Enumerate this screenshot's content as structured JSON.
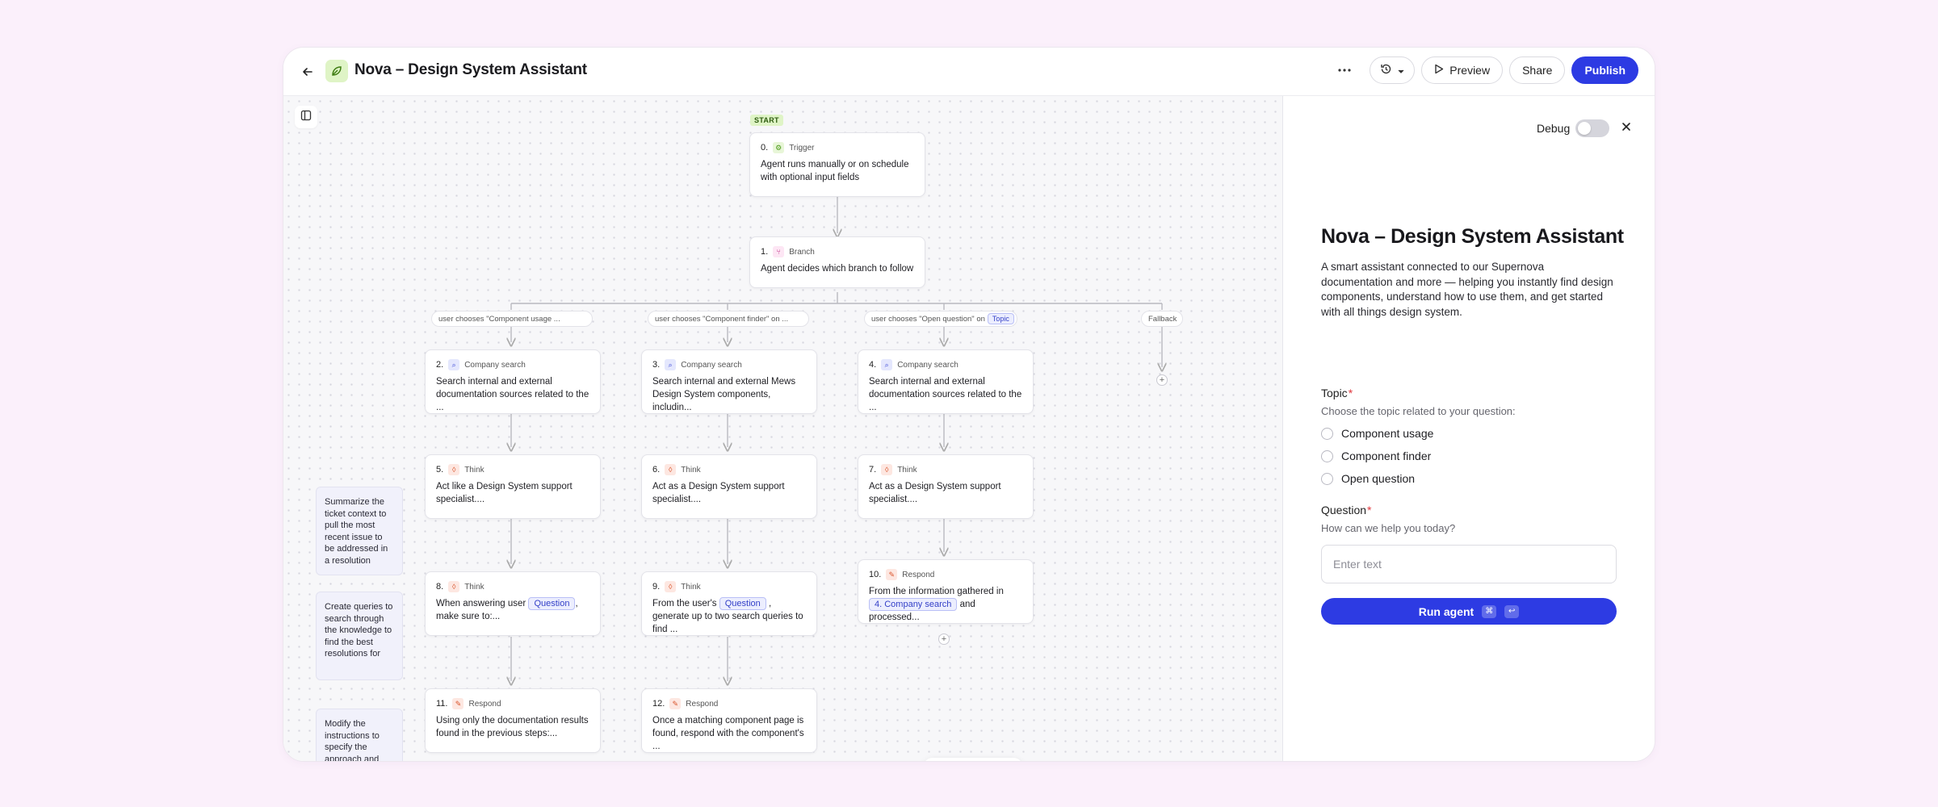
{
  "header": {
    "title": "Nova – Design System Assistant",
    "preview_label": "Preview",
    "share_label": "Share",
    "publish_label": "Publish"
  },
  "canvas": {
    "start_label": "START",
    "trigger": {
      "num": "0.",
      "type": "Trigger",
      "text": "Agent runs manually or on schedule with optional input fields"
    },
    "branch": {
      "num": "1.",
      "type": "Branch",
      "text": "Agent decides which branch to follow"
    },
    "conditions": [
      {
        "text": "user chooses \"Component usage ..."
      },
      {
        "text": "user chooses \"Component finder\" on ..."
      },
      {
        "text": "user chooses \"Open question\" on",
        "chip": "Topic"
      },
      {
        "text": "Fallback"
      }
    ],
    "nodes": {
      "n2": {
        "num": "2.",
        "type": "Company search",
        "text": "Search internal and external documentation sources related to the ..."
      },
      "n3": {
        "num": "3.",
        "type": "Company search",
        "text": "Search internal and external Mews Design System components, includin..."
      },
      "n4": {
        "num": "4.",
        "type": "Company search",
        "text": "Search internal and external documentation sources related to the ..."
      },
      "n5": {
        "num": "5.",
        "type": "Think",
        "text": "Act like a Design System support specialist...."
      },
      "n6": {
        "num": "6.",
        "type": "Think",
        "text": "Act as a Design System support specialist...."
      },
      "n7": {
        "num": "7.",
        "type": "Think",
        "text": "Act as a Design System support specialist...."
      },
      "n8": {
        "num": "8.",
        "type": "Think",
        "text_a": "When answering user",
        "chip": "Question",
        "text_b": ", make sure to:..."
      },
      "n9": {
        "num": "9.",
        "type": "Think",
        "text_a": "From the user's",
        "chip": "Question",
        "text_b": ", generate up to two search queries to find ..."
      },
      "n10": {
        "num": "10.",
        "type": "Respond",
        "text_a": "From the information gathered in",
        "chip": "4. Company search",
        "text_b": "and processed..."
      },
      "n11": {
        "num": "11.",
        "type": "Respond",
        "text": "Using only the documentation results found in the previous steps:..."
      },
      "n12": {
        "num": "12.",
        "type": "Respond",
        "text": "Once a matching component page is found, respond with the component's ..."
      }
    },
    "notes": [
      "Summarize the ticket context to pull the most recent issue to be addressed in a resolution",
      "Create queries to search through the knowledge to find the best resolutions for",
      "Modify the instructions to specify the approach and output format"
    ]
  },
  "side": {
    "debug_label": "Debug",
    "title": "Nova – Design System Assistant",
    "description": "A smart assistant connected to our Supernova documentation and more — helping you instantly find design components, understand how to use them, and get started with all things design system.",
    "topic_label": "Topic",
    "topic_help": "Choose the topic related to your question:",
    "topic_options": [
      "Component usage",
      "Component finder",
      "Open question"
    ],
    "question_label": "Question",
    "question_help": "How can we help you today?",
    "question_placeholder": "Enter text",
    "run_label": "Run agent",
    "required_mark": "*",
    "kbd_cmd": "⌘",
    "kbd_enter": "↩"
  },
  "colors": {
    "accent": "#2d3be3",
    "background": "#fbf0fb",
    "required": "#e0363c"
  }
}
